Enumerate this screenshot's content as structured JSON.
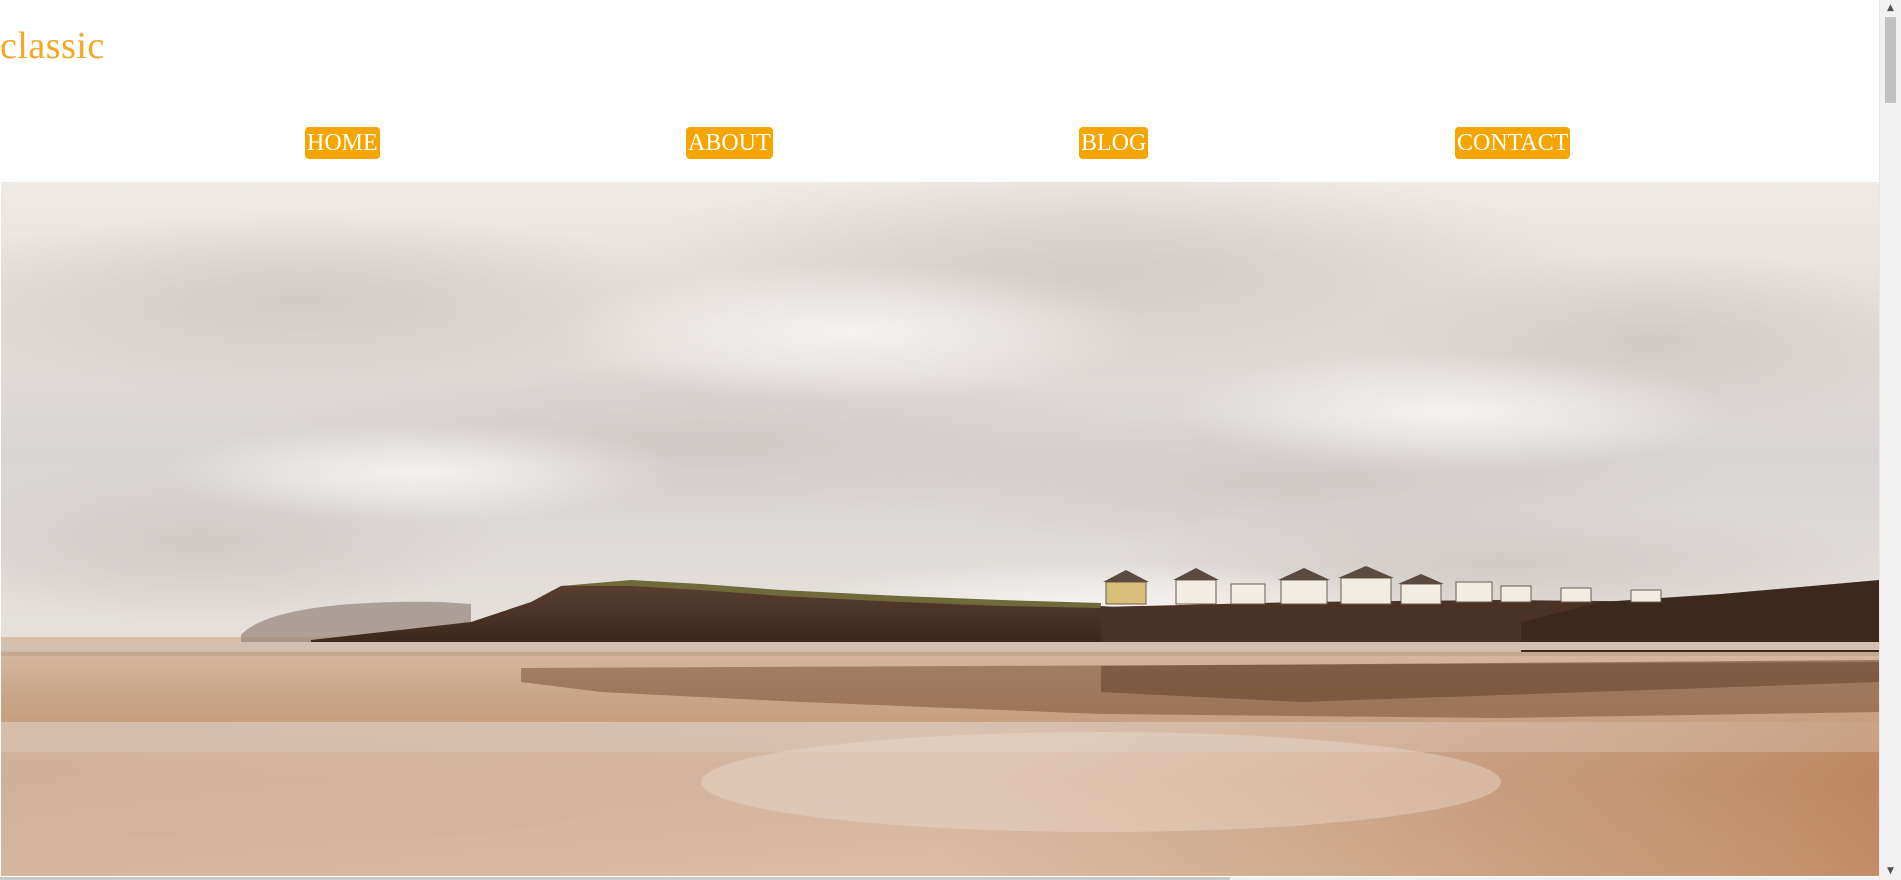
{
  "site": {
    "logo_text": "classic",
    "accent_color": "#f5a500"
  },
  "nav": {
    "items": [
      {
        "label": "HOME"
      },
      {
        "label": "ABOUT"
      },
      {
        "label": "BLOG"
      },
      {
        "label": "CONTACT"
      }
    ]
  },
  "hero": {
    "image_description": "beach-landscape-photo"
  },
  "scrollbar": {
    "up_icon": "▲",
    "down_icon": "▼"
  }
}
